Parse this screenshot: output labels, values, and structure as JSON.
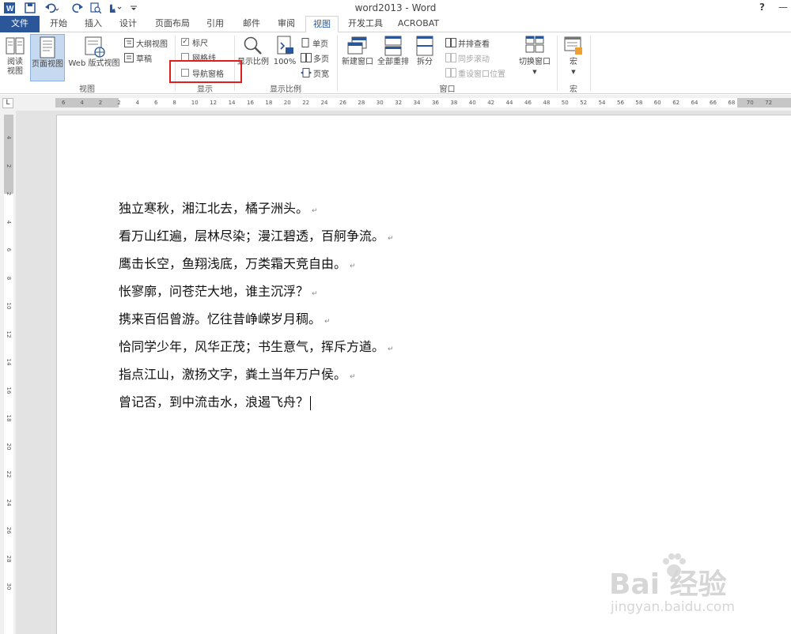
{
  "window": {
    "title": "word2013 - Word",
    "help": "?",
    "minimize": "—"
  },
  "quick_access": {
    "icons": [
      "word-icon",
      "save-icon",
      "undo-icon",
      "redo-icon",
      "print-preview-icon",
      "touch-mode-icon",
      "customize-icon"
    ]
  },
  "tabs": [
    {
      "label": "文件"
    },
    {
      "label": "开始"
    },
    {
      "label": "插入"
    },
    {
      "label": "设计"
    },
    {
      "label": "页面布局"
    },
    {
      "label": "引用"
    },
    {
      "label": "邮件"
    },
    {
      "label": "审阅"
    },
    {
      "label": "视图"
    },
    {
      "label": "开发工具"
    },
    {
      "label": "ACROBAT"
    }
  ],
  "active_tab": "视图",
  "ribbon": {
    "views": {
      "group_label": "视图",
      "read_mode": "阅读\n视图",
      "print_layout": "页面视图",
      "web_layout": "Web 版式视图",
      "outline": "大纲视图",
      "draft": "草稿"
    },
    "show": {
      "group_label": "显示",
      "ruler": "标尺",
      "ruler_checked": true,
      "gridlines": "网格线",
      "gridlines_checked": false,
      "nav_pane": "导航窗格",
      "nav_pane_checked": false
    },
    "zoom": {
      "group_label": "显示比例",
      "zoom": "显示比例",
      "hundred": "100%",
      "one_page": "单页",
      "multi_page": "多页",
      "page_width": "页宽"
    },
    "window": {
      "group_label": "窗口",
      "new_window": "新建窗口",
      "arrange_all": "全部重排",
      "split": "拆分",
      "side_by_side": "并排查看",
      "sync_scroll": "同步滚动",
      "reset_position": "重设窗口位置",
      "switch_windows": "切换窗口"
    },
    "macros": {
      "group_label": "宏",
      "macros": "宏"
    }
  },
  "ruler": {
    "corner": "L",
    "h_numbers": [
      "6",
      "4",
      "2",
      "2",
      "4",
      "6",
      "8",
      "10",
      "12",
      "14",
      "16",
      "18",
      "20",
      "22",
      "24",
      "26",
      "28",
      "30",
      "32",
      "34",
      "36",
      "38",
      "40",
      "42",
      "44",
      "46",
      "48",
      "50",
      "52",
      "54",
      "56",
      "58",
      "60",
      "62",
      "64",
      "66",
      "68",
      "70",
      "72"
    ],
    "v_numbers": [
      "4",
      "2",
      "2",
      "4",
      "6",
      "8",
      "10",
      "12",
      "14",
      "16",
      "18",
      "20",
      "22",
      "24",
      "26",
      "28",
      "30"
    ]
  },
  "document": {
    "lines": [
      "独立寒秋，湘江北去，橘子洲头。",
      "看万山红遍，层林尽染；漫江碧透，百舸争流。",
      "鹰击长空，鱼翔浅底，万类霜天竞自由。",
      "怅寥廓，问苍茫大地，谁主沉浮？",
      "携来百侣曾游。忆往昔峥嵘岁月稠。",
      "恰同学少年，风华正茂；书生意气，挥斥方遒。",
      "指点江山，激扬文字，粪土当年万户侯。",
      "曾记否，到中流击水，浪遏飞舟？"
    ],
    "paragraph_mark": "↵"
  },
  "watermark": {
    "logo": "Bai 经验",
    "url": "jingyan.baidu.com"
  },
  "colors": {
    "word_blue": "#2b579a",
    "highlight_red": "#e01e1e",
    "selected_button": "#c5d9f1"
  }
}
